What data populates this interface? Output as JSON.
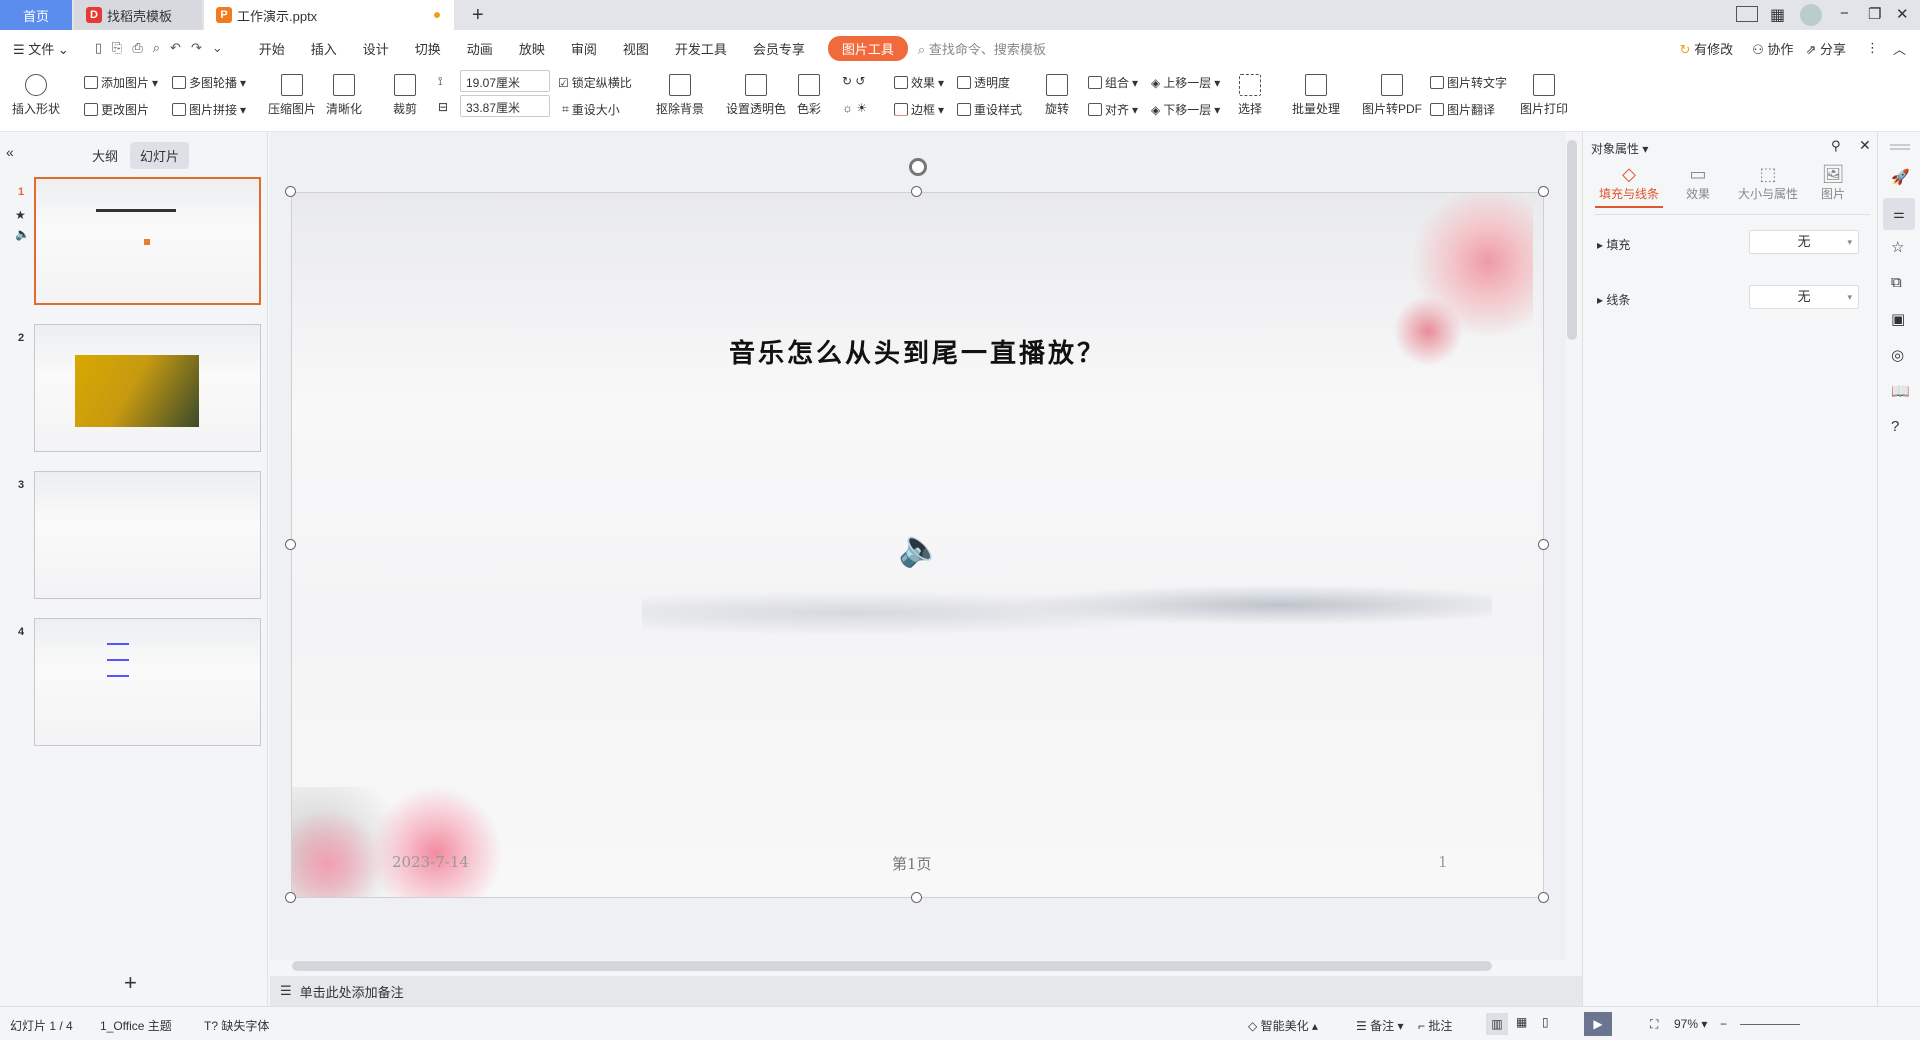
{
  "tabs": {
    "home": "首页",
    "template": "找稻壳模板",
    "doc": "工作演示.pptx",
    "new": "+"
  },
  "window": {
    "minimize": "−",
    "restore": "❐",
    "close": "✕"
  },
  "menu": {
    "file": "文件",
    "items": [
      "开始",
      "插入",
      "设计",
      "切换",
      "动画",
      "放映",
      "审阅",
      "视图",
      "开发工具",
      "会员专享"
    ],
    "active": "图片工具",
    "search_placeholder": "查找命令、搜索模板",
    "modified": "有修改",
    "collab": "协作",
    "share": "分享"
  },
  "ribbon": {
    "insert_shape": "插入形状",
    "add_pic": "添加图片",
    "multi_carousel": "多图轮播",
    "change_pic": "更改图片",
    "pic_stitch": "图片拼接",
    "compress": "压缩图片",
    "sharpen": "清晰化",
    "crop": "裁剪",
    "height": "19.07厘米",
    "width": "33.87厘米",
    "lock_ratio": "锁定纵横比",
    "lock_checked": true,
    "reset_size": "重设大小",
    "remove_bg": "抠除背景",
    "set_transparent": "设置透明色",
    "color": "色彩",
    "effects": "效果",
    "border": "边框",
    "transparency": "透明度",
    "reset_style": "重设样式",
    "rotate": "旋转",
    "group": "组合",
    "align": "对齐",
    "bring_forward": "上移一层",
    "send_backward": "下移一层",
    "select": "选择",
    "batch": "批量处理",
    "to_pdf": "图片转PDF",
    "to_text": "图片转文字",
    "translate": "图片翻译",
    "print": "图片打印"
  },
  "left": {
    "outline": "大纲",
    "slides": "幻灯片",
    "active_tab": "幻灯片",
    "thumbnails": [
      {
        "num": "1",
        "selected": true
      },
      {
        "num": "2"
      },
      {
        "num": "3"
      },
      {
        "num": "4"
      }
    ],
    "add": "+"
  },
  "slide": {
    "title": "音乐怎么从头到尾一直播放？",
    "date": "2023-7-14",
    "footer": "第1页",
    "page_number": "1",
    "audio_icon": "speaker-icon",
    "accent": "#e67e30"
  },
  "notes": {
    "placeholder": "单击此处添加备注"
  },
  "panel": {
    "title": "对象属性",
    "tabs": [
      "填充与线条",
      "效果",
      "大小与属性",
      "图片"
    ],
    "active_tab": "填充与线条",
    "accent": "#e0552b",
    "fill_label": "填充",
    "fill_value": "无",
    "line_label": "线条",
    "line_value": "无"
  },
  "status": {
    "slide": "幻灯片 1 / 4",
    "theme": "1_Office 主题",
    "missing_font": "缺失字体",
    "beautify": "智能美化",
    "notes": "备注",
    "comment": "批注",
    "zoom": "97%"
  }
}
